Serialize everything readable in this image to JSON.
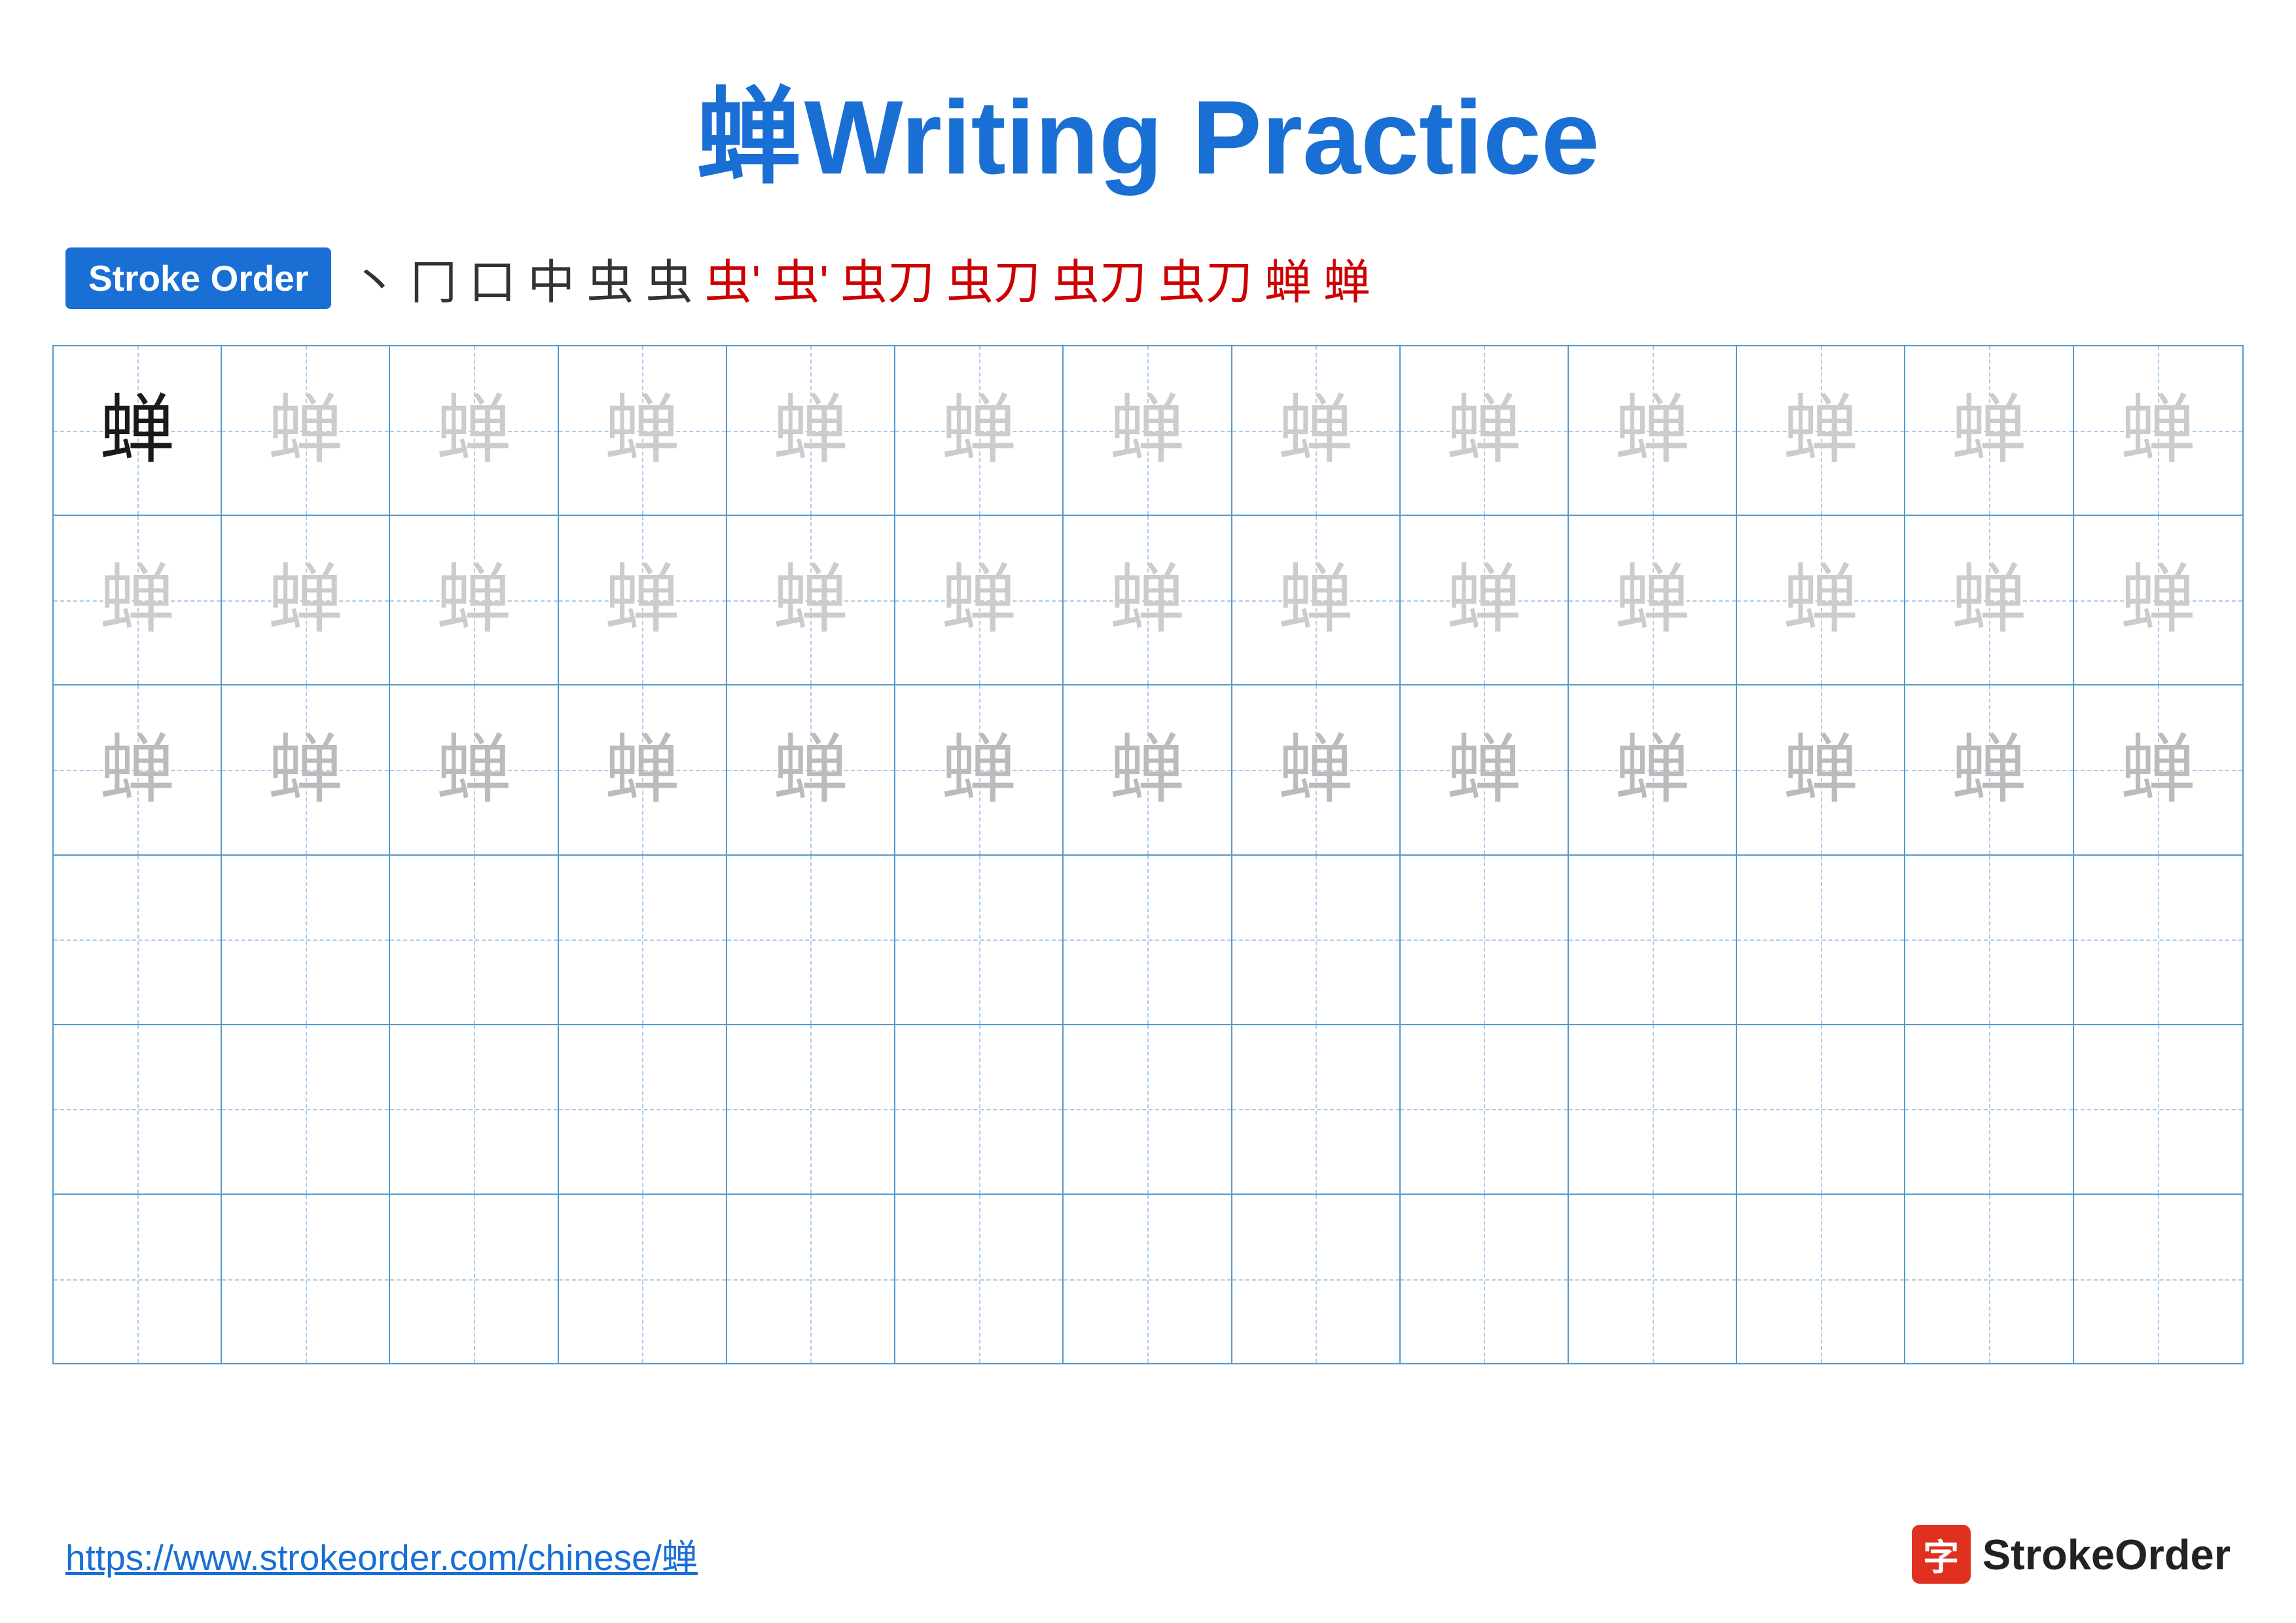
{
  "title": {
    "char": "蝉",
    "label": "Writing Practice"
  },
  "strokeOrder": {
    "badge": "Stroke Order",
    "steps": [
      "丶",
      "冂",
      "口",
      "中",
      "虫",
      "虫",
      "虫'",
      "虫'",
      "虫刀",
      "虫刀",
      "虫刀",
      "虫刀",
      "蝉",
      "蝉"
    ]
  },
  "grid": {
    "rows": 6,
    "cols": 13,
    "char": "蝉"
  },
  "footer": {
    "url": "https://www.strokeorder.com/chinese/蝉",
    "logoText": "StrokeOrder",
    "logoChar": "字"
  }
}
